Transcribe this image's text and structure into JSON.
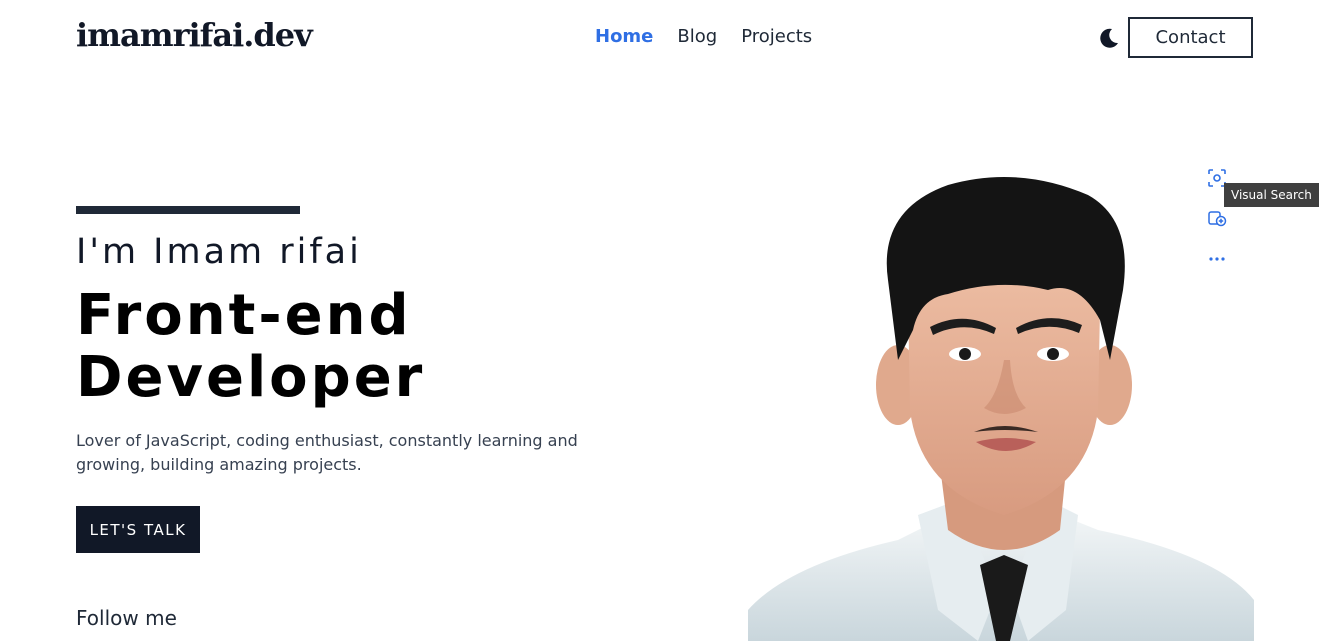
{
  "header": {
    "logo": "imamrifai.dev",
    "nav": [
      {
        "label": "Home",
        "active": true
      },
      {
        "label": "Blog",
        "active": false
      },
      {
        "label": "Projects",
        "active": false
      }
    ],
    "theme_icon": "moon-icon",
    "contact_label": "Contact"
  },
  "hero": {
    "greeting": "I'm Imam rifai",
    "title_line1": "Front-end",
    "title_line2": "Developer",
    "description": "Lover of JavaScript, coding enthusiast, constantly learning and growing, building amazing projects.",
    "cta_label": "LET'S TALK",
    "follow_label": "Follow me",
    "portrait": "cartoon-portrait-image"
  },
  "overlay": {
    "visual_search_icon": "visual-search-icon",
    "tooltip": "Visual Search",
    "collection_icon": "add-to-collection-icon",
    "more_icon": "more-dots-icon"
  },
  "colors": {
    "accent": "#2f6fe4",
    "dark": "#111827",
    "text": "#374151",
    "background": "#ffffff"
  }
}
